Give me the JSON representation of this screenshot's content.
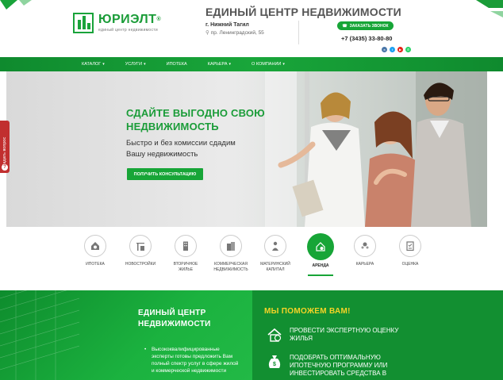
{
  "header": {
    "logo": {
      "name": "ЮРИЭЛТ",
      "reg": "®",
      "tagline": "единый центр недвижимости"
    },
    "site_title": "ЕДИНЫЙ ЦЕНТР НЕДВИЖИМОСТИ",
    "city": "г. Нижний Тагил",
    "address": "пр. Ленинградский, 55",
    "callback_label": "ЗАКАЗАТЬ ЗВОНОК",
    "phone": "+7 (3435) 33-80-80",
    "socials": [
      {
        "icon": "vk-icon",
        "color": "#4a76a8"
      },
      {
        "icon": "twitter-icon",
        "color": "#1da1f2"
      },
      {
        "icon": "youtube-icon",
        "color": "#e62117"
      },
      {
        "icon": "whatsapp-icon",
        "color": "#25d366"
      }
    ]
  },
  "nav": {
    "items": [
      {
        "label": "КАТАЛОГ",
        "has_dropdown": true
      },
      {
        "label": "УСЛУГИ",
        "has_dropdown": true
      },
      {
        "label": "ИПОТЕКА",
        "has_dropdown": false
      },
      {
        "label": "КАРЬЕРА",
        "has_dropdown": true
      },
      {
        "label": "О КОМПАНИИ",
        "has_dropdown": true
      }
    ]
  },
  "hero": {
    "title_line1": "СДАЙТЕ ВЫГОДНО СВОЮ",
    "title_line2": "НЕДВИЖИМОСТЬ",
    "subtitle_line1": "Быстро и без комиссии сдадим",
    "subtitle_line2": "Вашу недвижимость",
    "button_label": "ПОЛУЧИТЬ КОНСУЛЬТАЦИЮ"
  },
  "side_tab": {
    "label": "Задать вопрос",
    "icon": "question-icon"
  },
  "services": {
    "items": [
      {
        "line1": "ИПОТЕКА",
        "line2": "",
        "icon": "mortgage-icon",
        "active": false
      },
      {
        "line1": "НОВОСТРОЙКИ",
        "line2": "",
        "icon": "crane-icon",
        "active": false
      },
      {
        "line1": "ВТОРИЧНОЕ",
        "line2": "ЖИЛЬЕ",
        "icon": "building-icon",
        "active": false
      },
      {
        "line1": "КОММЕРЧЕСКАЯ",
        "line2": "НЕДВИЖИМОСТЬ",
        "icon": "office-icon",
        "active": false
      },
      {
        "line1": "МАТЕРИНСКИЙ",
        "line2": "КАПИТАЛ",
        "icon": "family-icon",
        "active": false
      },
      {
        "line1": "АРЕНДА",
        "line2": "",
        "icon": "rent-house-icon",
        "active": true
      },
      {
        "line1": "КАРЬЕРА",
        "line2": "",
        "icon": "career-icon",
        "active": false
      },
      {
        "line1": "ОЦЕНКА",
        "line2": "",
        "icon": "checklist-icon",
        "active": false
      }
    ]
  },
  "about": {
    "title_line1": "ЕДИНЫЙ ЦЕНТР",
    "title_line2": "НЕДВИЖИМОСТИ",
    "bullet": "Высококвалифицированные эксперты готовы предложить Вам полный спектр услуг в сфере жилой и коммерческой недвижимости"
  },
  "help": {
    "title": "МЫ ПОМОЖЕМ ВАМ!",
    "items": [
      {
        "text": "ПРОВЕСТИ ЭКСПЕРТНУЮ ОЦЕНКУ ЖИЛЬЯ",
        "icon": "house-check-icon"
      },
      {
        "text": "ПОДОБРАТЬ ОПТИМАЛЬНУЮ ИПОТЕЧНУЮ ПРОГРАММУ ИЛИ ИНВЕСТИРОВАТЬ СРЕДСТВА В",
        "icon": "money-bag-icon"
      }
    ]
  },
  "colors": {
    "brand_green": "#17a537",
    "dark_green": "#128f31",
    "accent_yellow": "#f5d326",
    "side_tab_red": "#c12f2f"
  }
}
